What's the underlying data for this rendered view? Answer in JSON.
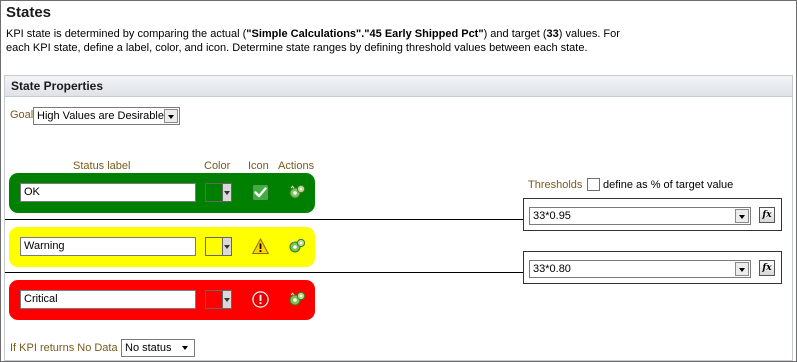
{
  "header": {
    "title": "States",
    "desc": {
      "part1": "KPI state is determined by comparing the actual (",
      "actual_ref": "\"Simple Calculations\".\"45 Early Shipped Pct\"",
      "part2": ") and target (",
      "target_value": "33",
      "part3": ") values. For each KPI state, define a label, color, and icon. Determine state ranges by defining threshold values between each state."
    }
  },
  "panel": {
    "title": "State Properties",
    "goal": {
      "label": "Goal",
      "value": "High Values are Desirable"
    },
    "columns": {
      "status_label": "Status label",
      "color": "Color",
      "icon": "Icon",
      "actions": "Actions"
    },
    "states": [
      {
        "label": "OK",
        "color": "#008000",
        "icon": "checkmark-icon",
        "action_icon": "gear-action-icon"
      },
      {
        "label": "Warning",
        "color": "#ffff00",
        "icon": "warning-icon",
        "action_icon": "gear-action-icon"
      },
      {
        "label": "Critical",
        "color": "#ff0000",
        "icon": "error-icon",
        "action_icon": "gear-action-icon"
      }
    ],
    "thresholds": {
      "label": "Thresholds",
      "pct_label": "define as % of target value",
      "pct_checked": false,
      "values": [
        "33*0.95",
        "33*0.80"
      ],
      "fx_label": "fx"
    },
    "no_data": {
      "label": "If KPI returns No Data",
      "value": "No status"
    }
  }
}
